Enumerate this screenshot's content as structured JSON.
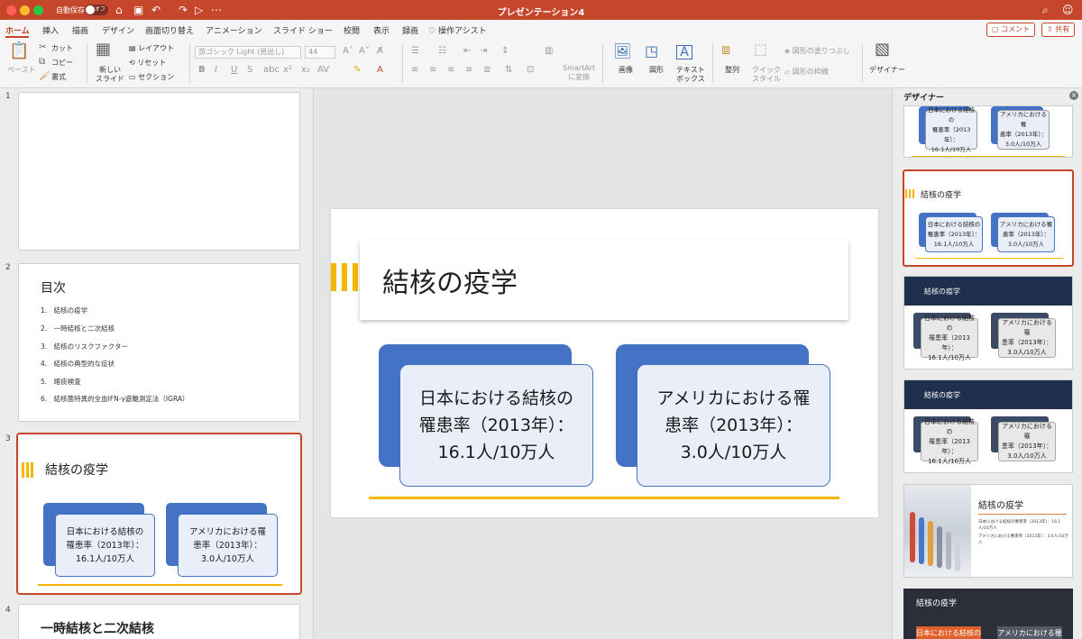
{
  "window": {
    "title": "プレゼンテーション4",
    "autosave_label": "自動保存",
    "autosave_state": "オフ"
  },
  "tabs": [
    "ホーム",
    "挿入",
    "描画",
    "デザイン",
    "画面切り替え",
    "アニメーション",
    "スライド ショー",
    "校閲",
    "表示",
    "録画"
  ],
  "tell_me": "操作アシスト",
  "comment_label": "コメント",
  "share_label": "共有",
  "ribbon": {
    "paste": "ペースト",
    "cut": "カット",
    "copy": "コピー",
    "format": "書式",
    "new_slide": "新しい\nスライド",
    "layout": "レイアウト",
    "reset": "リセット",
    "section": "セクション",
    "font_name": "游ゴシック Light (見出し)",
    "font_size": "44",
    "smartart": "SmartArt\nに変換",
    "picture": "画像",
    "shape": "図形",
    "textbox": "テキスト\nボックス",
    "arrange": "整列",
    "quick_style": "クイック\nスタイル",
    "shape_fill": "図形の塗りつぶし",
    "shape_outline": "図形の枠線",
    "designer": "デザイナー"
  },
  "thumbnails": {
    "numbers": [
      "1",
      "2",
      "3",
      "4"
    ],
    "toc_title": "目次",
    "toc_items": [
      "1.　結核の疫学",
      "2.　一時結核と二次結核",
      "3.　結核のリスクファクター",
      "4.　結核の典型的な症状",
      "5.　喀痰検査",
      "6.　結核菌特異的全血IFN-γ遊離測定法（IGRA）"
    ],
    "slide4_title": "一時結核と二次結核"
  },
  "slide": {
    "title": "結核の疫学",
    "box1": "日本における結核の\n罹患率（2013年）：\n16.1人/10万人",
    "box2": "アメリカにおける罹\n患率（2013年）：\n3.0人/10万人"
  },
  "designer": {
    "title": "デザイナー",
    "card_title": "結核の疫学",
    "small1": "日本における結核の\n罹患率（2013年）：\n16.1人/10万人",
    "small2": "アメリカにおける罹\n患率（2013年）：\n3.0人/10万人",
    "bullet1": "日本における結核の罹患率（2013年）：16.1人/10万人",
    "bullet2": "アメリカにおける罹患率（2013年）：3.0人/10万人",
    "dark_box1": "日本における結核の",
    "dark_box2": "アメリカにおける罹"
  },
  "colors": {
    "accent": "#c5462a",
    "blue": "#4472c4",
    "yellow": "#f5b800",
    "navy": "#1f2f4e"
  }
}
